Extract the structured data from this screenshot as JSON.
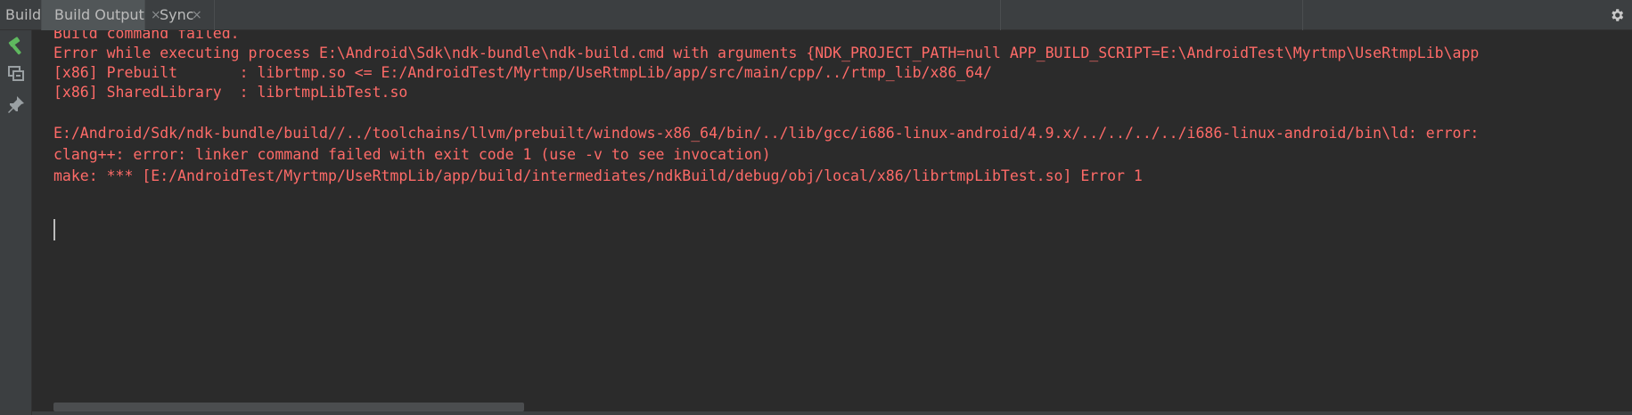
{
  "header": {
    "build_label": "Build:",
    "tabs": [
      {
        "label": "Build Output",
        "active": true,
        "close": "×"
      },
      {
        "label": "Sync",
        "active": false,
        "close": "×"
      }
    ],
    "settings_icon": "gear-icon"
  },
  "toolbar": {
    "icons": [
      "hammer-icon",
      "restore-layout-icon",
      "pin-icon"
    ]
  },
  "console": {
    "lines": [
      "Build command failed.",
      "Error while executing process E:\\Android\\Sdk\\ndk-bundle\\ndk-build.cmd with arguments {NDK_PROJECT_PATH=null APP_BUILD_SCRIPT=E:\\AndroidTest\\Myrtmp\\UseRtmpLib\\app",
      "[x86] Prebuilt       : librtmp.so <= E:/AndroidTest/Myrtmp/UseRtmpLib/app/src/main/cpp/../rtmp_lib/x86_64/",
      "[x86] SharedLibrary  : librtmpLibTest.so",
      "",
      "E:/Android/Sdk/ndk-bundle/build//../toolchains/llvm/prebuilt/windows-x86_64/bin/../lib/gcc/i686-linux-android/4.9.x/../../../../i686-linux-android/bin\\ld: error:",
      "clang++: error: linker command failed with exit code 1 (use -v to see invocation)",
      "make: *** [E:/AndroidTest/Myrtmp/UseRtmpLib/app/build/intermediates/ndkBuild/debug/obj/local/x86/librtmpLibTest.so] Error 1"
    ],
    "error_color": "#ff6b68"
  },
  "colors": {
    "background": "#2b2b2b",
    "panel": "#3c3f41",
    "active_tab": "#515658",
    "hammer": "#5fb85f"
  }
}
